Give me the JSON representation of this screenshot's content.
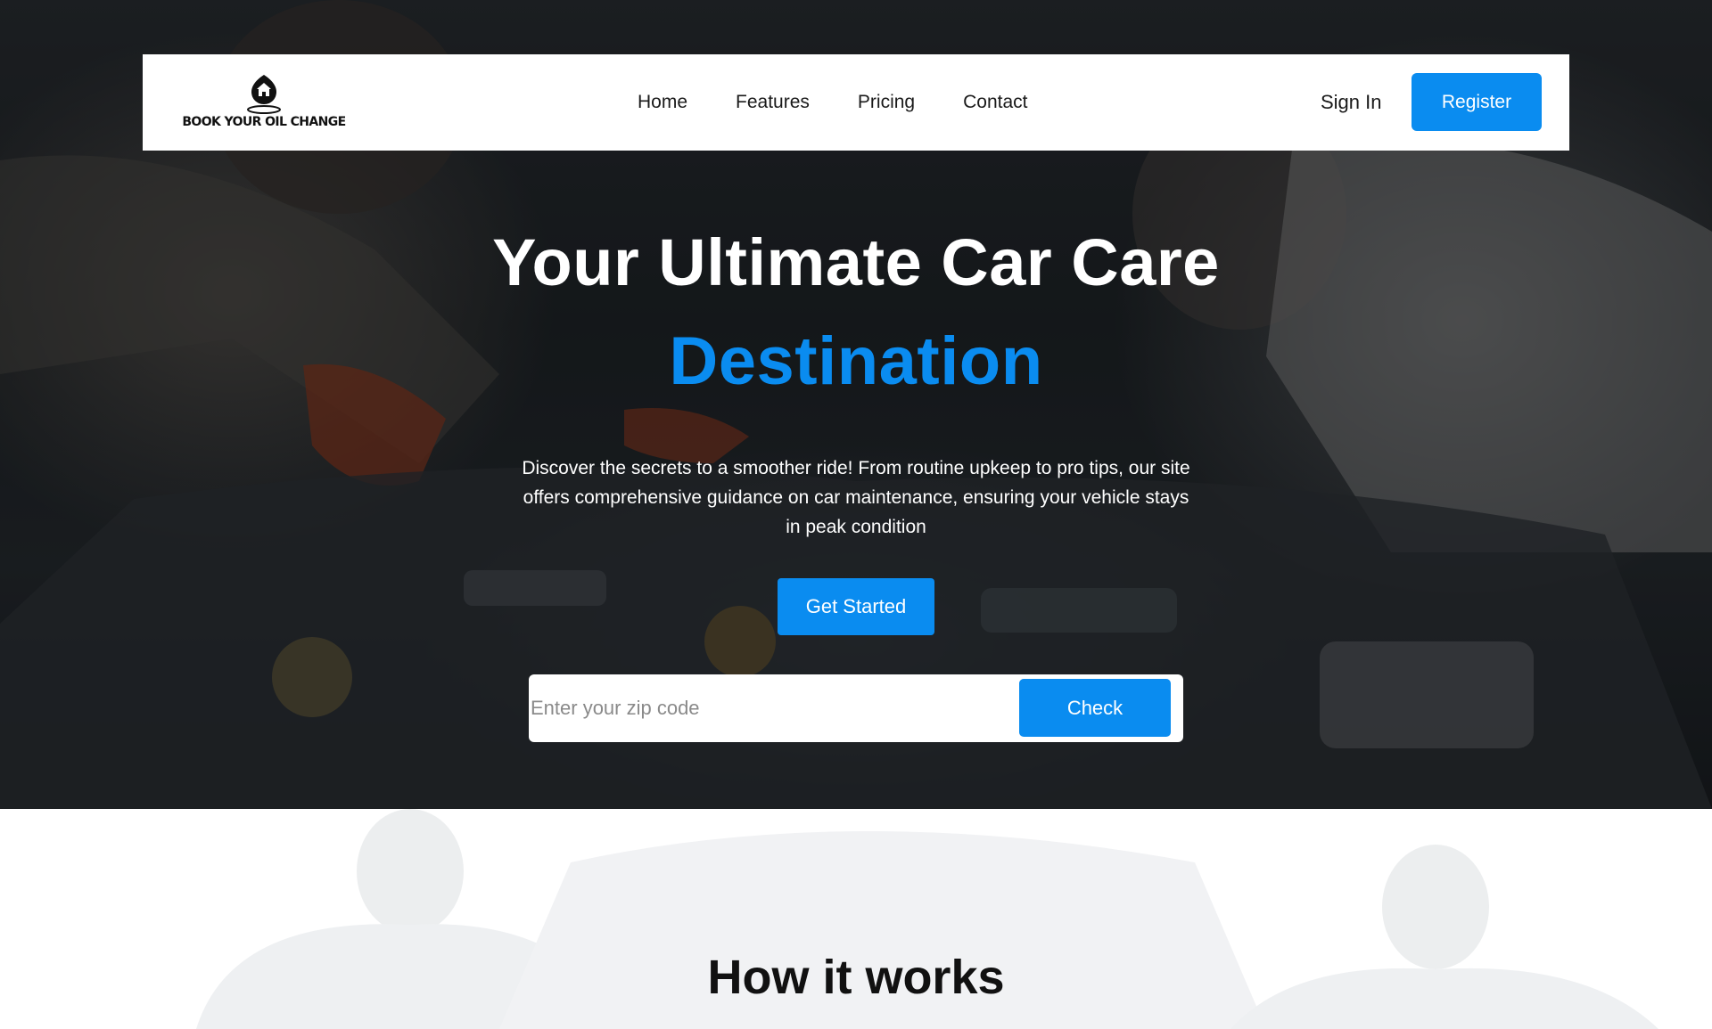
{
  "brand": {
    "logo_text": "BOOK YOUR OIL CHANGE"
  },
  "nav": {
    "links": [
      "Home",
      "Features",
      "Pricing",
      "Contact"
    ],
    "sign_in": "Sign In",
    "register": "Register"
  },
  "hero": {
    "title": "Your Ultimate Car Care",
    "title_accent": "Destination",
    "description": "Discover the secrets to a smoother ride! From routine upkeep to pro tips, our site offers comprehensive guidance on car maintenance, ensuring your vehicle stays in peak condition",
    "cta": "Get Started",
    "zip_placeholder": "Enter your zip code",
    "zip_value": "",
    "check": "Check"
  },
  "how": {
    "title": "How it works"
  },
  "colors": {
    "accent": "#0a8cf0",
    "nav_bg": "#ffffff",
    "hero_text": "#ffffff"
  }
}
